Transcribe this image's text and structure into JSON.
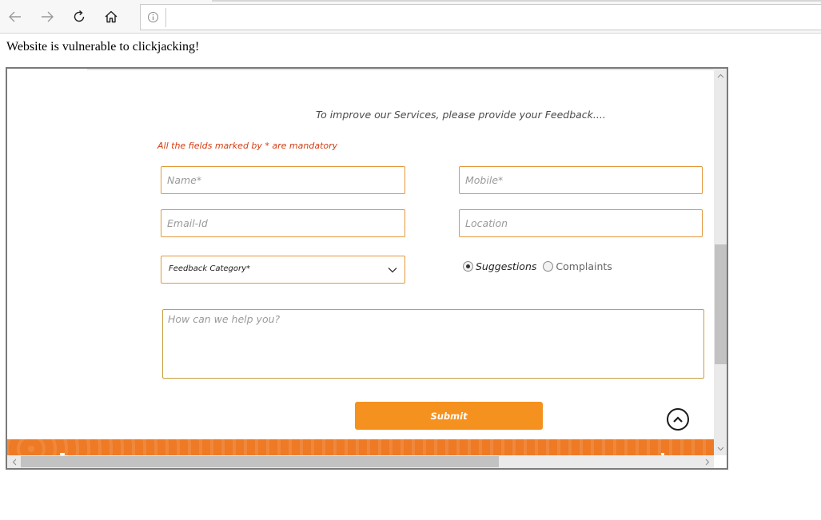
{
  "browser": {
    "address_value": "",
    "icons": [
      "back-arrow-icon",
      "forward-arrow-icon",
      "refresh-icon",
      "home-icon",
      "info-icon"
    ]
  },
  "page": {
    "vulnerable_message": "Website is vulnerable to clickjacking!"
  },
  "form": {
    "intro": "To improve our Services, please provide your Feedback....",
    "mandatory_note": "All the fields marked by * are mandatory",
    "name_placeholder": "Name*",
    "mobile_placeholder": "Mobile*",
    "email_placeholder": "Email-Id",
    "location_placeholder": "Location",
    "category_label": "Feedback Category*",
    "radio_options": [
      "Suggestions",
      "Complaints"
    ],
    "selected_radio": "Suggestions",
    "message_placeholder": "How can we help you?",
    "submit_label": "Submit"
  },
  "colors": {
    "accent_orange": "#f5911e",
    "field_border": "#e4973b",
    "mandatory_red": "#d43b0f",
    "footer_band": "#ee7a25"
  }
}
